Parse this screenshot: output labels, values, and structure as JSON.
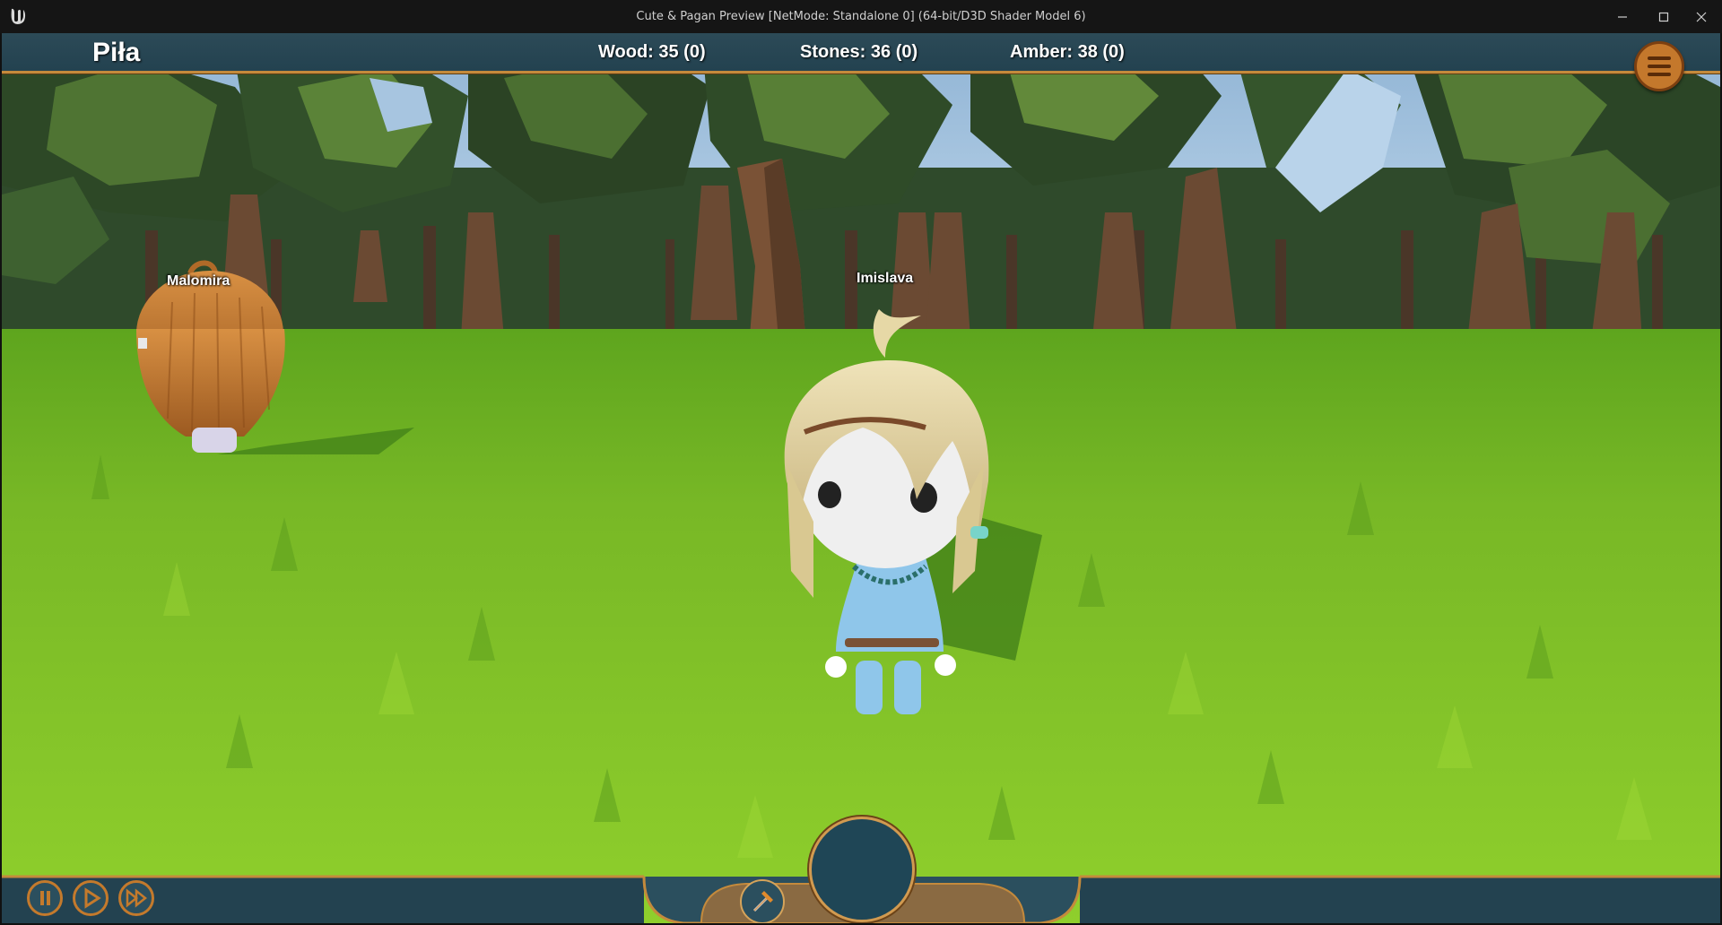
{
  "window": {
    "title": "Cute & Pagan Preview [NetMode: Standalone 0]  (64-bit/D3D Shader Model 6)",
    "logo_icon": "unreal-engine-logo",
    "controls": [
      "minimize-icon",
      "maximize-icon",
      "close-icon"
    ]
  },
  "hud": {
    "location": "Piła",
    "resources": [
      {
        "label": "Wood: 35 (0)"
      },
      {
        "label": "Stones: 36 (0)"
      },
      {
        "label": "Amber: 38 (0)"
      }
    ],
    "menu_icon": "hamburger-menu-icon"
  },
  "characters": [
    {
      "name": "Malomira"
    },
    {
      "name": "Imislava"
    }
  ],
  "bottom": {
    "time_controls": [
      "pause-icon",
      "play-icon",
      "fast-forward-icon"
    ],
    "tool_icon": "hammer-icon",
    "minimap": "minimap"
  },
  "colors": {
    "hud_bar": "#234250",
    "hud_border": "#c48a3c",
    "button_orange": "#c4782c",
    "grass": "#7fbf2a",
    "sky": "#a9c7e2"
  }
}
